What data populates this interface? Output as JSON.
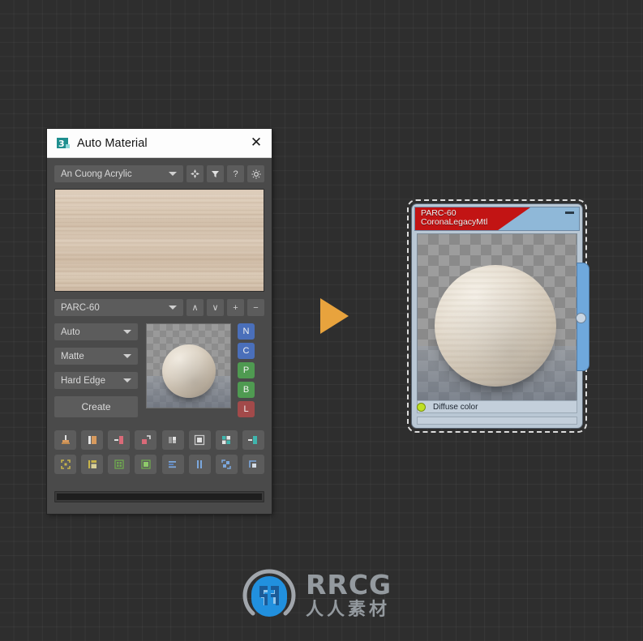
{
  "viewport": {
    "background_color": "#2e2e2e",
    "grid_color": "#383838"
  },
  "dialog": {
    "title": "Auto Material",
    "app_icon": "3dsmax-icon",
    "close_label": "✕",
    "library": {
      "value": "An Cuong Acrylic",
      "caret_icon": "chevron-down-icon"
    },
    "toolbar_buttons": [
      {
        "name": "move-icon",
        "glyph": "❖"
      },
      {
        "name": "filter-funnel-icon",
        "glyph": "▼"
      },
      {
        "name": "help-icon",
        "glyph": "?"
      },
      {
        "name": "settings-gear-icon",
        "glyph": "☀"
      }
    ],
    "texture_preview": {
      "name": "wood-texture-preview",
      "description": "An Cuong Acrylic wood grain swatch"
    },
    "material": {
      "value": "PARC-60",
      "caret_icon": "chevron-down-icon"
    },
    "material_buttons": [
      {
        "name": "move-up-button",
        "glyph": "∧"
      },
      {
        "name": "move-down-button",
        "glyph": "∨"
      },
      {
        "name": "add-button",
        "glyph": "+"
      },
      {
        "name": "remove-button",
        "glyph": "−"
      }
    ],
    "options": [
      {
        "name": "renderer-mode",
        "value": "Auto"
      },
      {
        "name": "surface-finish",
        "value": "Matte"
      },
      {
        "name": "edge-mode",
        "value": "Hard Edge"
      }
    ],
    "create_label": "Create",
    "sphere_preview_name": "material-sphere-preview",
    "channels": [
      {
        "label": "N",
        "color": "#4a6fba",
        "name": "channel-normal"
      },
      {
        "label": "C",
        "color": "#4a6fba",
        "name": "channel-color"
      },
      {
        "label": "P",
        "color": "#4f9a51",
        "name": "channel-displacement"
      },
      {
        "label": "B",
        "color": "#4f9a51",
        "name": "channel-bump"
      },
      {
        "label": "L",
        "color": "#a24a4a",
        "name": "channel-light"
      }
    ],
    "icon_grid": [
      [
        {
          "name": "apply-to-object-icon",
          "color": "#d79a5e"
        },
        {
          "name": "split-material-icon",
          "color": "#d79a5e"
        },
        {
          "name": "remove-material-icon",
          "color": "#d96a78"
        },
        {
          "name": "extract-material-icon",
          "color": "#d96a78"
        },
        {
          "name": "compare-material-icon",
          "color": "#c8c8c8"
        },
        {
          "name": "center-material-icon",
          "color": "#c8c8c8"
        },
        {
          "name": "multi-material-icon",
          "color": "#3fb5ad"
        },
        {
          "name": "assign-material-icon",
          "color": "#3fb5ad"
        }
      ],
      [
        {
          "name": "select-by-material-icon",
          "color": "#c8b44a"
        },
        {
          "name": "material-list-icon",
          "color": "#c8b44a"
        },
        {
          "name": "tile-material-icon",
          "color": "#6fa84f"
        },
        {
          "name": "fill-material-icon",
          "color": "#6fa84f"
        },
        {
          "name": "align-material-icon",
          "color": "#5b87c9"
        },
        {
          "name": "split-columns-icon",
          "color": "#5b87c9"
        },
        {
          "name": "swap-material-icon",
          "color": "#5b87c9"
        },
        {
          "name": "resize-material-icon",
          "color": "#c0c8d2"
        }
      ]
    ],
    "progress_name": "horizontal-scrollbar"
  },
  "arrow": {
    "name": "orange-play-arrow",
    "color": "#e8a33d"
  },
  "node": {
    "title_line1": "PARC-60",
    "title_line2": "CoronaLegacyMtl",
    "header_accent_color": "#c21414",
    "header_color": "#8fb8d8",
    "minimize_name": "node-minimize-button",
    "thumbnail_name": "node-material-thumbnail",
    "socket": {
      "label": "Diffuse color",
      "dot_color": "#bfe024"
    },
    "output_socket_name": "node-output-socket",
    "selected": true
  },
  "watermark": {
    "brand": "RRCG",
    "subtitle": "人人素材",
    "logo_name": "rrcg-logo-icon"
  }
}
